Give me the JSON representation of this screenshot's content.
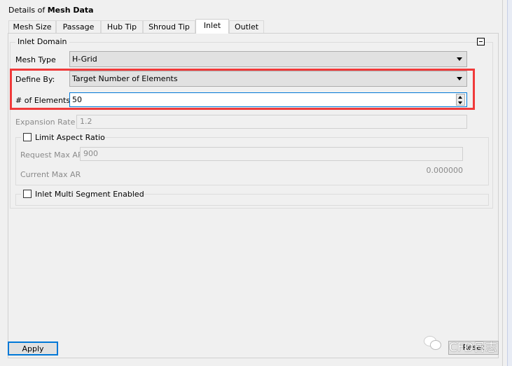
{
  "header": {
    "prefix": "Details of ",
    "title": "Mesh Data"
  },
  "tabs": [
    {
      "label": "Mesh Size"
    },
    {
      "label": "Passage"
    },
    {
      "label": "Hub Tip"
    },
    {
      "label": "Shroud Tip"
    },
    {
      "label": "Inlet",
      "active": true
    },
    {
      "label": "Outlet"
    }
  ],
  "inlet_domain": {
    "title": "Inlet Domain",
    "mesh_type": {
      "label": "Mesh Type",
      "value": "H-Grid"
    },
    "define_by": {
      "label": "Define By:",
      "value": "Target Number of Elements"
    },
    "num_elements": {
      "label": "# of Elements",
      "value": "50"
    },
    "expansion_rate": {
      "label": "Expansion Rate",
      "value": "1.2"
    },
    "limit_aspect": {
      "label": "Limit Aspect Ratio",
      "checked": false,
      "request_max_ar": {
        "label": "Request Max AR",
        "value": "900"
      },
      "current_max_ar": {
        "label": "Current Max AR",
        "value": "0.000000"
      }
    },
    "multi_segment": {
      "label": "Inlet Multi Segment Enabled",
      "checked": false
    }
  },
  "buttons": {
    "apply": "Apply",
    "reset": "Reset"
  },
  "watermark": "CFD日志",
  "colors": {
    "highlight": "#f03a3a",
    "focus": "#0078d7"
  }
}
